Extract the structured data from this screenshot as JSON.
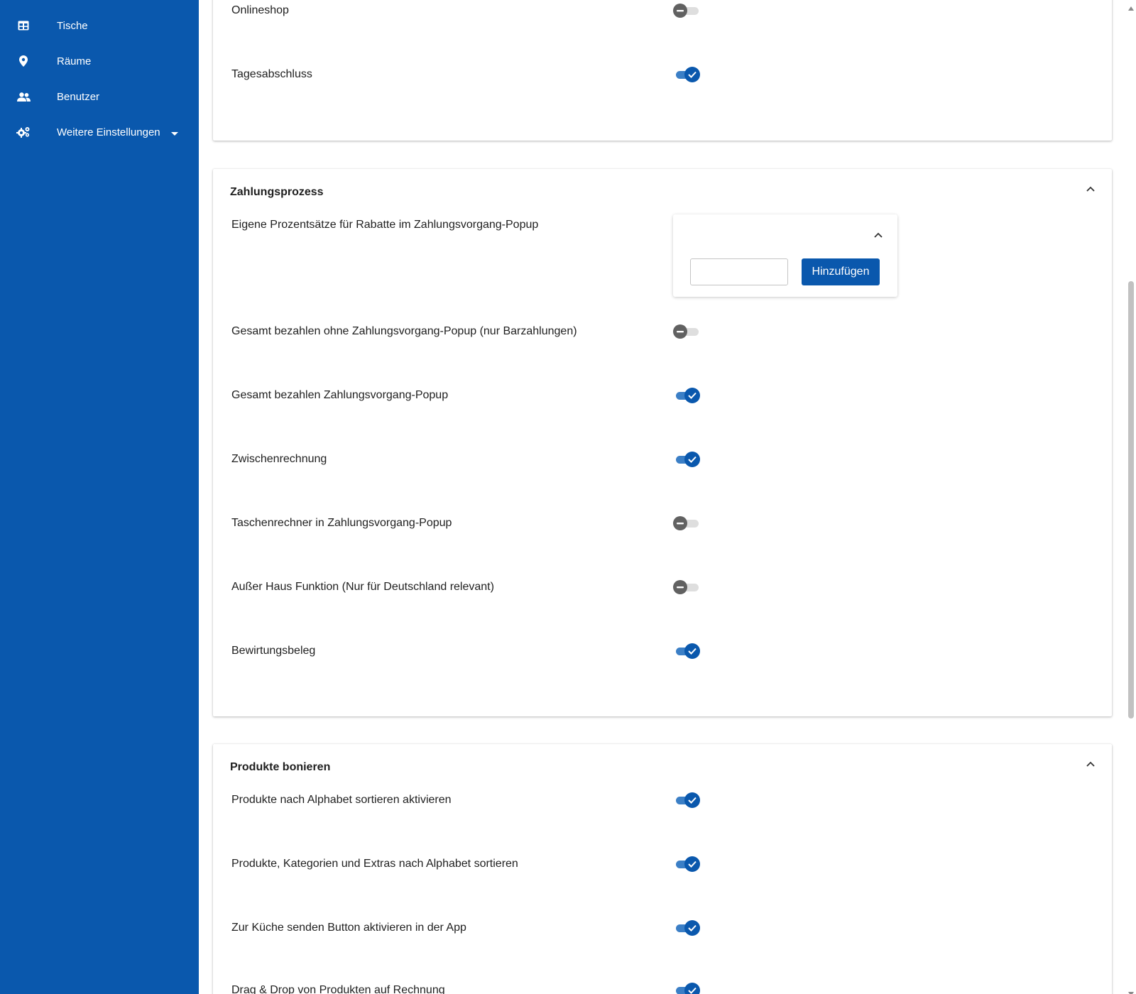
{
  "sidebar": {
    "items": [
      {
        "label": "Tische",
        "icon": "table-icon"
      },
      {
        "label": "Räume",
        "icon": "location-pin-icon"
      },
      {
        "label": "Benutzer",
        "icon": "users-icon"
      },
      {
        "label": "Weitere Einstellungen",
        "icon": "gears-icon"
      }
    ]
  },
  "sections": {
    "general_tail": {
      "settings": [
        {
          "label": "Onlineshop",
          "enabled": false
        },
        {
          "label": "Tagesabschluss",
          "enabled": true
        }
      ]
    },
    "payment": {
      "title": "Zahlungsprozess",
      "discount_label": "Eigene Prozentsätze für Rabatte im Zahlungsvorgang-Popup",
      "discount_input_value": "",
      "add_button_label": "Hinzufügen",
      "settings": [
        {
          "label": "Gesamt bezahlen ohne Zahlungsvorgang-Popup (nur Barzahlungen)",
          "enabled": false
        },
        {
          "label": "Gesamt bezahlen Zahlungsvorgang-Popup",
          "enabled": true
        },
        {
          "label": "Zwischenrechnung",
          "enabled": true
        },
        {
          "label": "Taschenrechner in Zahlungsvorgang-Popup",
          "enabled": false
        },
        {
          "label": "Außer Haus Funktion (Nur für Deutschland relevant)",
          "enabled": false
        },
        {
          "label": "Bewirtungsbeleg",
          "enabled": true
        }
      ]
    },
    "products": {
      "title": "Produkte bonieren",
      "settings": [
        {
          "label": "Produkte nach Alphabet sortieren aktivieren",
          "enabled": true
        },
        {
          "label": "Produkte, Kategorien und Extras nach Alphabet sortieren",
          "enabled": true
        },
        {
          "label": "Zur Küche senden Button aktivieren in der App",
          "enabled": true
        },
        {
          "label": "Drag & Drop von Produkten auf Rechnung",
          "enabled": true
        }
      ]
    }
  },
  "colors": {
    "primary": "#0a58ad",
    "toggle_track_on": "#3b7fc6",
    "toggle_off_knob": "#616161",
    "toggle_off_track": "#dedede"
  }
}
